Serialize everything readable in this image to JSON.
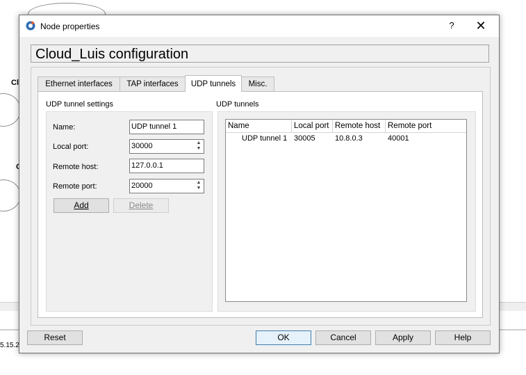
{
  "background": {
    "canvas_labels": [
      "Cl",
      "C"
    ],
    "status_text": "5.15.2"
  },
  "dialog": {
    "title": "Node properties",
    "help_label": "?",
    "close_label": "✕",
    "config_title": "Cloud_Luis configuration",
    "tabs": [
      {
        "label": "Ethernet interfaces",
        "active": false
      },
      {
        "label": "TAP interfaces",
        "active": false
      },
      {
        "label": "UDP tunnels",
        "active": true
      },
      {
        "label": "Misc.",
        "active": false
      }
    ],
    "settings": {
      "title": "UDP tunnel settings",
      "name_label": "Name:",
      "name_value": "UDP tunnel 1",
      "local_port_label": "Local port:",
      "local_port_value": "30000",
      "remote_host_label": "Remote host:",
      "remote_host_value": "127.0.0.1",
      "remote_port_label": "Remote port:",
      "remote_port_value": "20000",
      "add_label": "Add",
      "delete_label": "Delete"
    },
    "tunnels": {
      "title": "UDP tunnels",
      "columns": [
        "Name",
        "Local port",
        "Remote host",
        "Remote port"
      ],
      "rows": [
        {
          "name": "UDP tunnel 1",
          "local_port": "30005",
          "remote_host": "10.8.0.3",
          "remote_port": "40001"
        }
      ]
    },
    "buttons": {
      "reset": "Reset",
      "ok": "OK",
      "cancel": "Cancel",
      "apply": "Apply",
      "help": "Help"
    }
  }
}
